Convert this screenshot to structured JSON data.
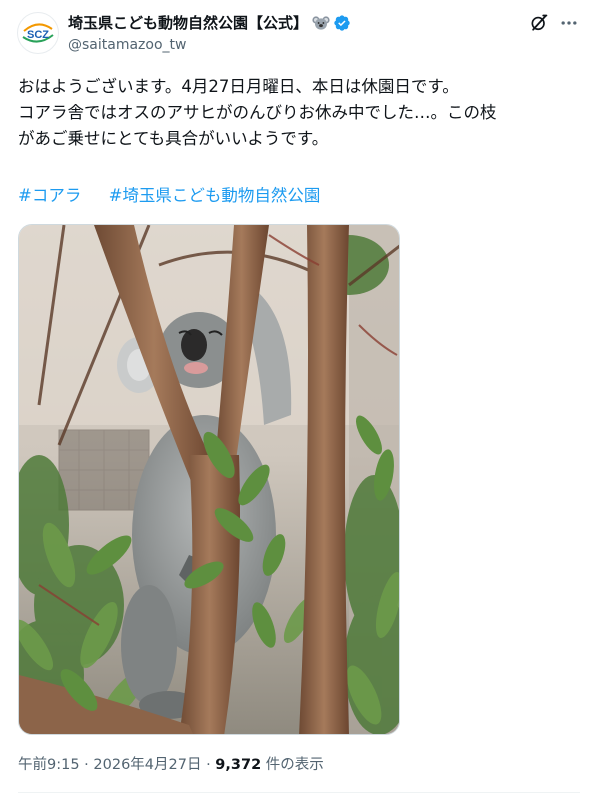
{
  "account": {
    "display_name": "埼玉県こども動物自然公園【公式】",
    "handle": "@saitamazoo_tw",
    "avatar_text": "SCZ",
    "name_emoji": "koala-emoji",
    "verified": true,
    "brand_color": "#1d9bf0"
  },
  "header_icons": {
    "grok": "grok-icon",
    "more": "more-icon"
  },
  "tweet": {
    "lines": [
      "おはようございます。4月27日月曜日、本日は休園日です。",
      "コアラ舎ではオスのアサヒがのんびりお休み中でした…。この枝",
      "があご乗せにとても具合がいいようです。"
    ],
    "hashtags": [
      "#コアラ",
      "#埼玉県こども動物自然公園"
    ],
    "photo_alt": "コアラのアサヒ"
  },
  "meta": {
    "time": "午前9:15",
    "separator": "·",
    "date": "2026年4月27日",
    "views_count": "9,372",
    "views_label": "件の表示"
  },
  "colors": {
    "text": "#0f1419",
    "secondary": "#536471",
    "link": "#1d9bf0"
  }
}
